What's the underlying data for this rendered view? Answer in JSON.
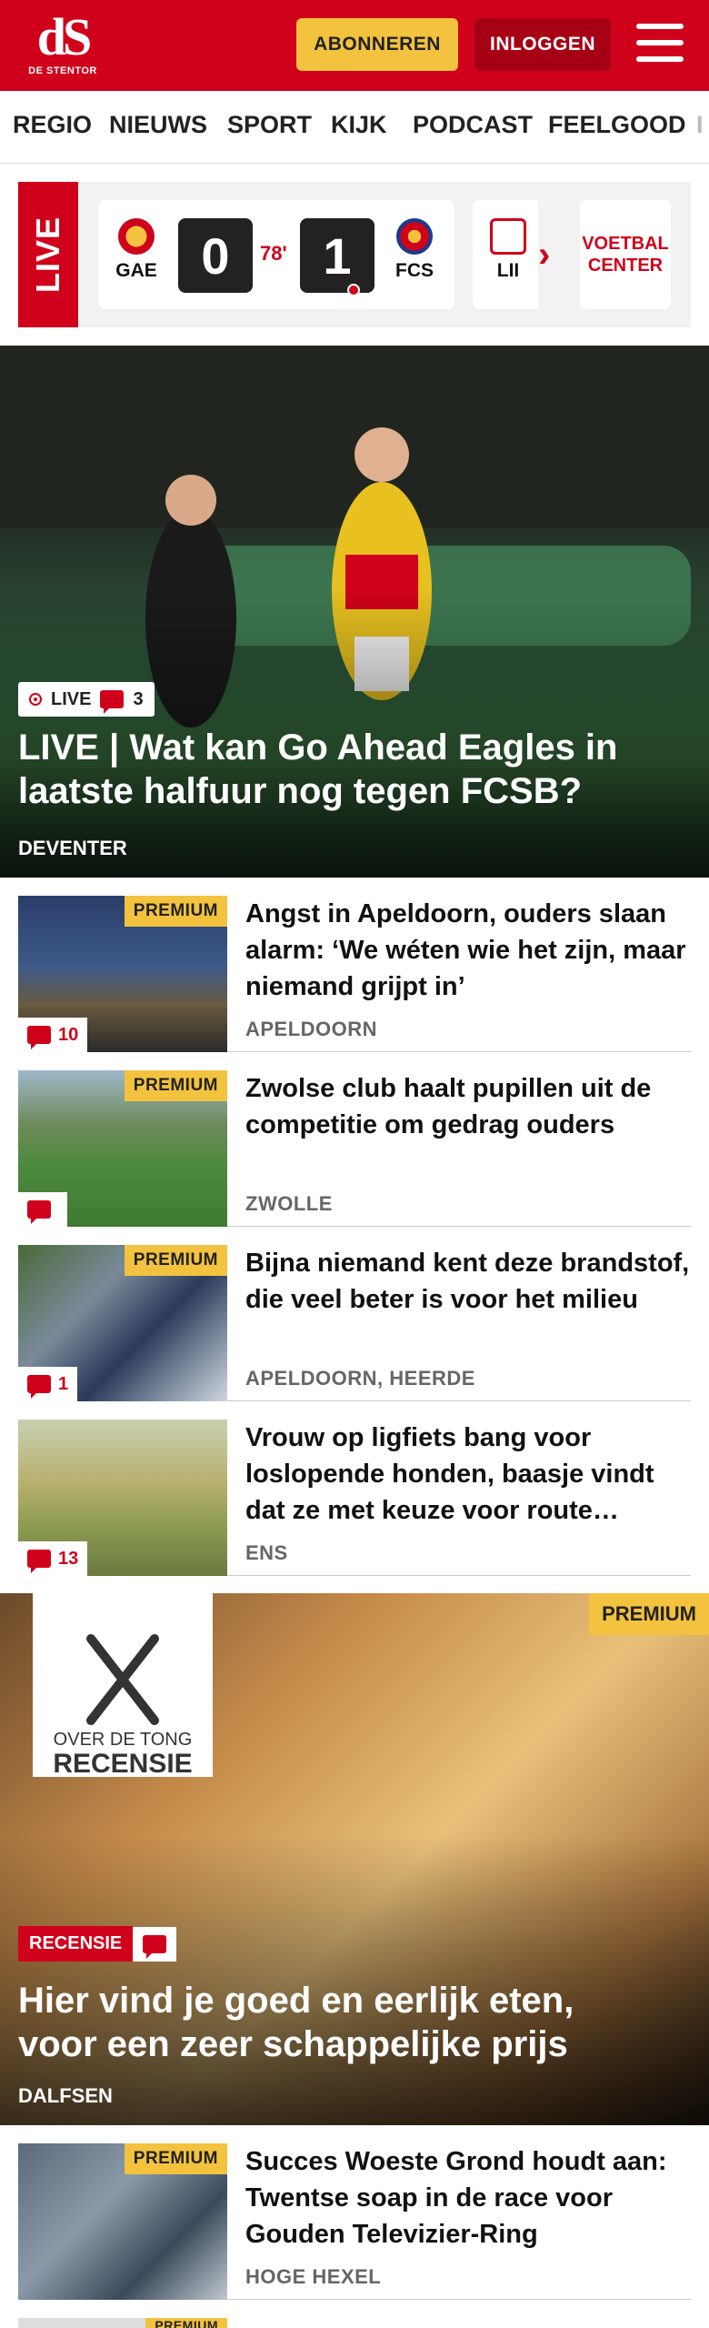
{
  "header": {
    "logo_mark": "dS",
    "logo_text": "DE STENTOR",
    "subscribe_label": "ABONNEREN",
    "login_label": "INLOGGEN"
  },
  "nav": {
    "items": [
      "REGIO",
      "NIEUWS",
      "SPORT",
      "KIJK",
      "PODCAST",
      "FEELGOOD",
      "I"
    ]
  },
  "scoreboard": {
    "live_label": "LIVE",
    "match": {
      "home_team": "GAE",
      "away_team": "FCS",
      "home_score": "0",
      "away_score": "1",
      "minute": "78'"
    },
    "next_team_abbr": "LII",
    "voetbal_center_label": "VOETBAL CENTER"
  },
  "hero": {
    "badge_live": "LIVE",
    "comment_count": "3",
    "title": "LIVE | Wat kan Go Ahead Eagles in laatste halfuur nog tegen FCSB?",
    "location": "DEVENTER"
  },
  "articles": [
    {
      "premium": "PREMIUM",
      "comments": "10",
      "title": "Angst in Apeldoorn, ouders slaan alarm: ‘We wéten wie het zijn, maar niemand grijpt in’",
      "location": "APELDOORN"
    },
    {
      "premium": "PREMIUM",
      "comments": "",
      "title": "Zwolse club haalt pupillen uit de competitie om gedrag ouders",
      "location": "ZWOLLE"
    },
    {
      "premium": "PREMIUM",
      "comments": "1",
      "title": "Bijna niemand kent deze brandstof, die veel beter is voor het milieu",
      "location": "APELDOORN, HEERDE"
    },
    {
      "premium": "",
      "comments": "13",
      "title": "Vrouw op ligfiets bang voor loslopende honden, baasje vindt dat ze met keuze voor route…",
      "location": "ENS"
    }
  ],
  "feature": {
    "tong_line1": "OVER DE TONG",
    "tong_line2": "RECENSIE",
    "premium": "PREMIUM",
    "label": "RECENSIE",
    "title": "Hier vind je goed en eerlijk eten, voor een zeer schappelijke prijs",
    "location": "DALFSEN"
  },
  "article_last": {
    "premium": "PREMIUM",
    "title": "Succes Woeste Grond houdt aan: Twentse soap in de race voor Gouden Televizier-Ring",
    "location": "HOGE HEXEL"
  },
  "partial_next": {
    "premium": "PREMIUM"
  },
  "colors": {
    "brand_red": "#d0021b",
    "premium_yellow": "#f3c23e"
  }
}
